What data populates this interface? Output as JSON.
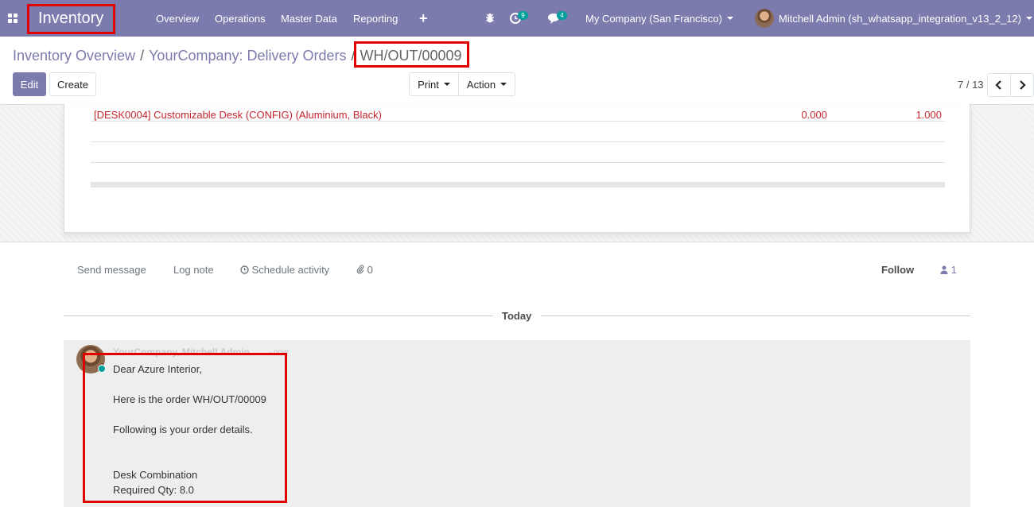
{
  "navbar": {
    "app_name": "Inventory",
    "menu": [
      "Overview",
      "Operations",
      "Master Data",
      "Reporting"
    ],
    "activity_count": "9",
    "message_count": "4",
    "company": "My Company (San Francisco)",
    "user": "Mitchell Admin (sh_whatsapp_integration_v13_2_12)",
    "colors": {
      "bar": "#7c7bad",
      "badge": "#00a09d",
      "highlight": "#e00000"
    }
  },
  "breadcrumb": {
    "items": [
      "Inventory Overview",
      "YourCompany: Delivery Orders"
    ],
    "current": "WH/OUT/00009"
  },
  "control": {
    "edit_label": "Edit",
    "create_label": "Create",
    "print_label": "Print",
    "action_label": "Action",
    "pager": "7 / 13"
  },
  "move_lines": [
    {
      "product": "[DESK0004] Customizable Desk (CONFIG) (Aluminium, Black)",
      "reserved": "0.000",
      "done": "1.000"
    }
  ],
  "chatter": {
    "send_message": "Send message",
    "log_note": "Log note",
    "schedule_activity": "Schedule activity",
    "attachments": "0",
    "follow_label": "Follow",
    "followers": "1",
    "day_label": "Today",
    "message": {
      "author": "YourCompany, Mitchell Admin",
      "time": "- now",
      "lines": [
        "Dear Azure Interior,",
        "Here is the order WH/OUT/00009",
        "Following is your order details.",
        "Desk Combination",
        "Required Qty: 8.0"
      ]
    }
  }
}
